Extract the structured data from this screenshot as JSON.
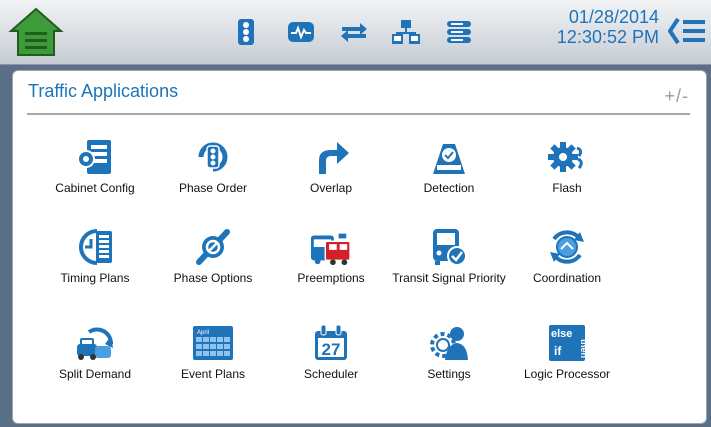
{
  "header": {
    "date": "01/28/2014",
    "time": "12:30:52 PM",
    "icons": [
      "home-icon",
      "traffic-signal-icon",
      "pulse-monitor-icon",
      "swap-arrows-icon",
      "network-icon",
      "server-stack-icon",
      "menu-icon"
    ],
    "accent": "#1f74b9",
    "home_color": "#4caf50"
  },
  "panel": {
    "title": "Traffic Applications",
    "toggle_label": "+/-",
    "apps": [
      {
        "label": "Cabinet Config",
        "icon": "cabinet-config-icon"
      },
      {
        "label": "Phase Order",
        "icon": "phase-order-icon"
      },
      {
        "label": "Overlap",
        "icon": "overlap-icon"
      },
      {
        "label": "Detection",
        "icon": "detection-icon"
      },
      {
        "label": "Flash",
        "icon": "flash-icon"
      },
      {
        "label": "Timing Plans",
        "icon": "timing-plans-icon"
      },
      {
        "label": "Phase Options",
        "icon": "phase-options-icon"
      },
      {
        "label": "Preemptions",
        "icon": "preemptions-icon"
      },
      {
        "label": "Transit Signal Priority",
        "icon": "transit-signal-priority-icon"
      },
      {
        "label": "Coordination",
        "icon": "coordination-icon"
      },
      {
        "label": "Split Demand",
        "icon": "split-demand-icon"
      },
      {
        "label": "Event Plans",
        "icon": "event-plans-icon"
      },
      {
        "label": "Scheduler",
        "icon": "scheduler-icon"
      },
      {
        "label": "Settings",
        "icon": "settings-icon"
      },
      {
        "label": "Logic Processor",
        "icon": "logic-processor-icon"
      }
    ],
    "calendar_month": "April",
    "calendar_day": "27",
    "logic_words": [
      "else",
      "if",
      "then"
    ]
  }
}
